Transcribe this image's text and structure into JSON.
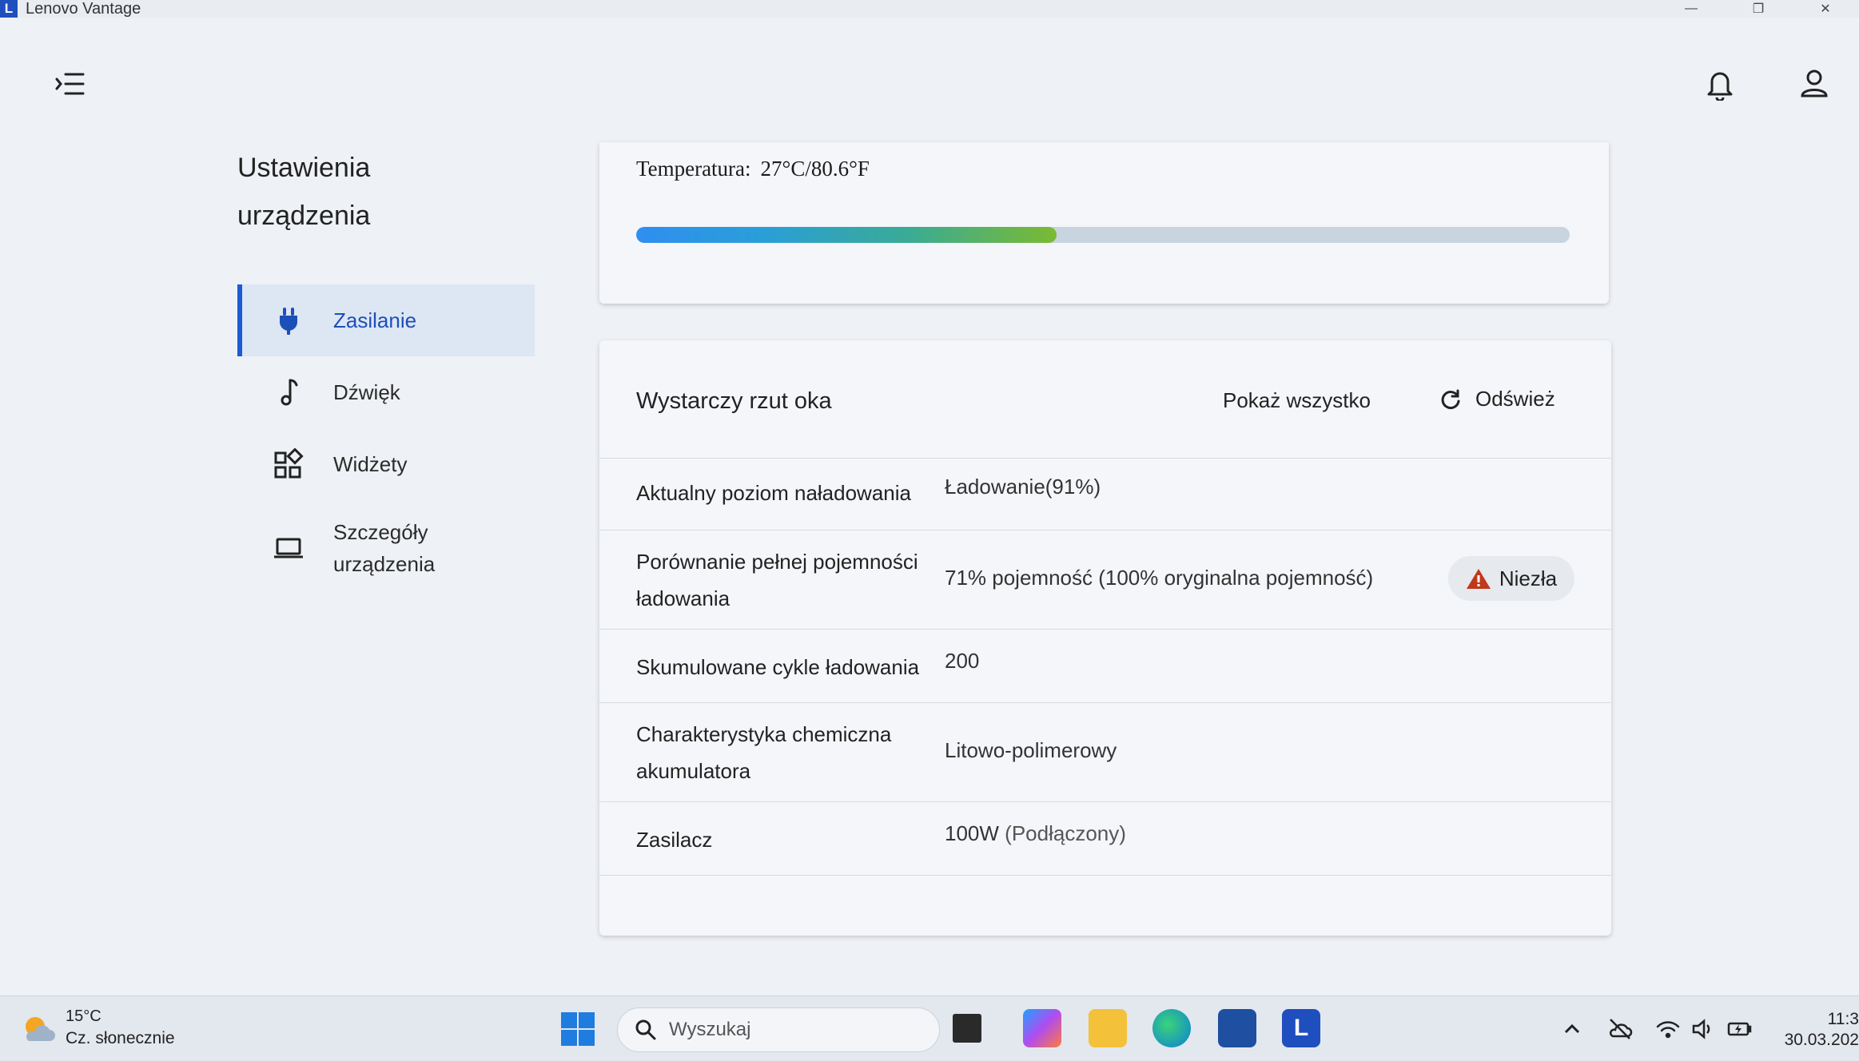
{
  "window": {
    "title": "Lenovo Vantage",
    "logo_letter": "L"
  },
  "sidebar": {
    "title_line1": "Ustawienia",
    "title_line2": "urządzenia",
    "items": [
      {
        "label": "Zasilanie",
        "active": true
      },
      {
        "label": "Dźwięk",
        "active": false
      },
      {
        "label": "Widżety",
        "active": false
      },
      {
        "label": "Szczegóły urządzenia",
        "active": false
      }
    ]
  },
  "temperature": {
    "label": "Temperatura:",
    "value": "27°C/80.6°F",
    "bar_fraction": 0.45
  },
  "glance": {
    "title": "Wystarczy rzut oka",
    "show_all": "Pokaż wszystko",
    "refresh": "Odśwież",
    "rows": [
      {
        "label": "Aktualny poziom naładowania",
        "value": "Ładowanie(91%)"
      },
      {
        "label": "Porównanie pełnej pojemności ładowania",
        "value": "71% pojemność (100% oryginalna pojemność)",
        "badge": "Niezła"
      },
      {
        "label": "Skumulowane cykle ładowania",
        "value": "200"
      },
      {
        "label": "Charakterystyka chemiczna akumulatora",
        "value": "Litowo-polimerowy"
      },
      {
        "label": "Zasilacz",
        "value": "100W",
        "value_muted": "(Podłączony)"
      }
    ]
  },
  "taskbar": {
    "weather_temp": "15°C",
    "weather_cond": "Cz. słonecznie",
    "search_placeholder": "Wyszukaj",
    "time": "11:3",
    "date": "30.03.202"
  },
  "colors": {
    "accent": "#1d5bd6",
    "warning": "#c0391b",
    "temp_gradient": [
      "#2f8ff0",
      "#3aab94",
      "#7bba32"
    ]
  }
}
